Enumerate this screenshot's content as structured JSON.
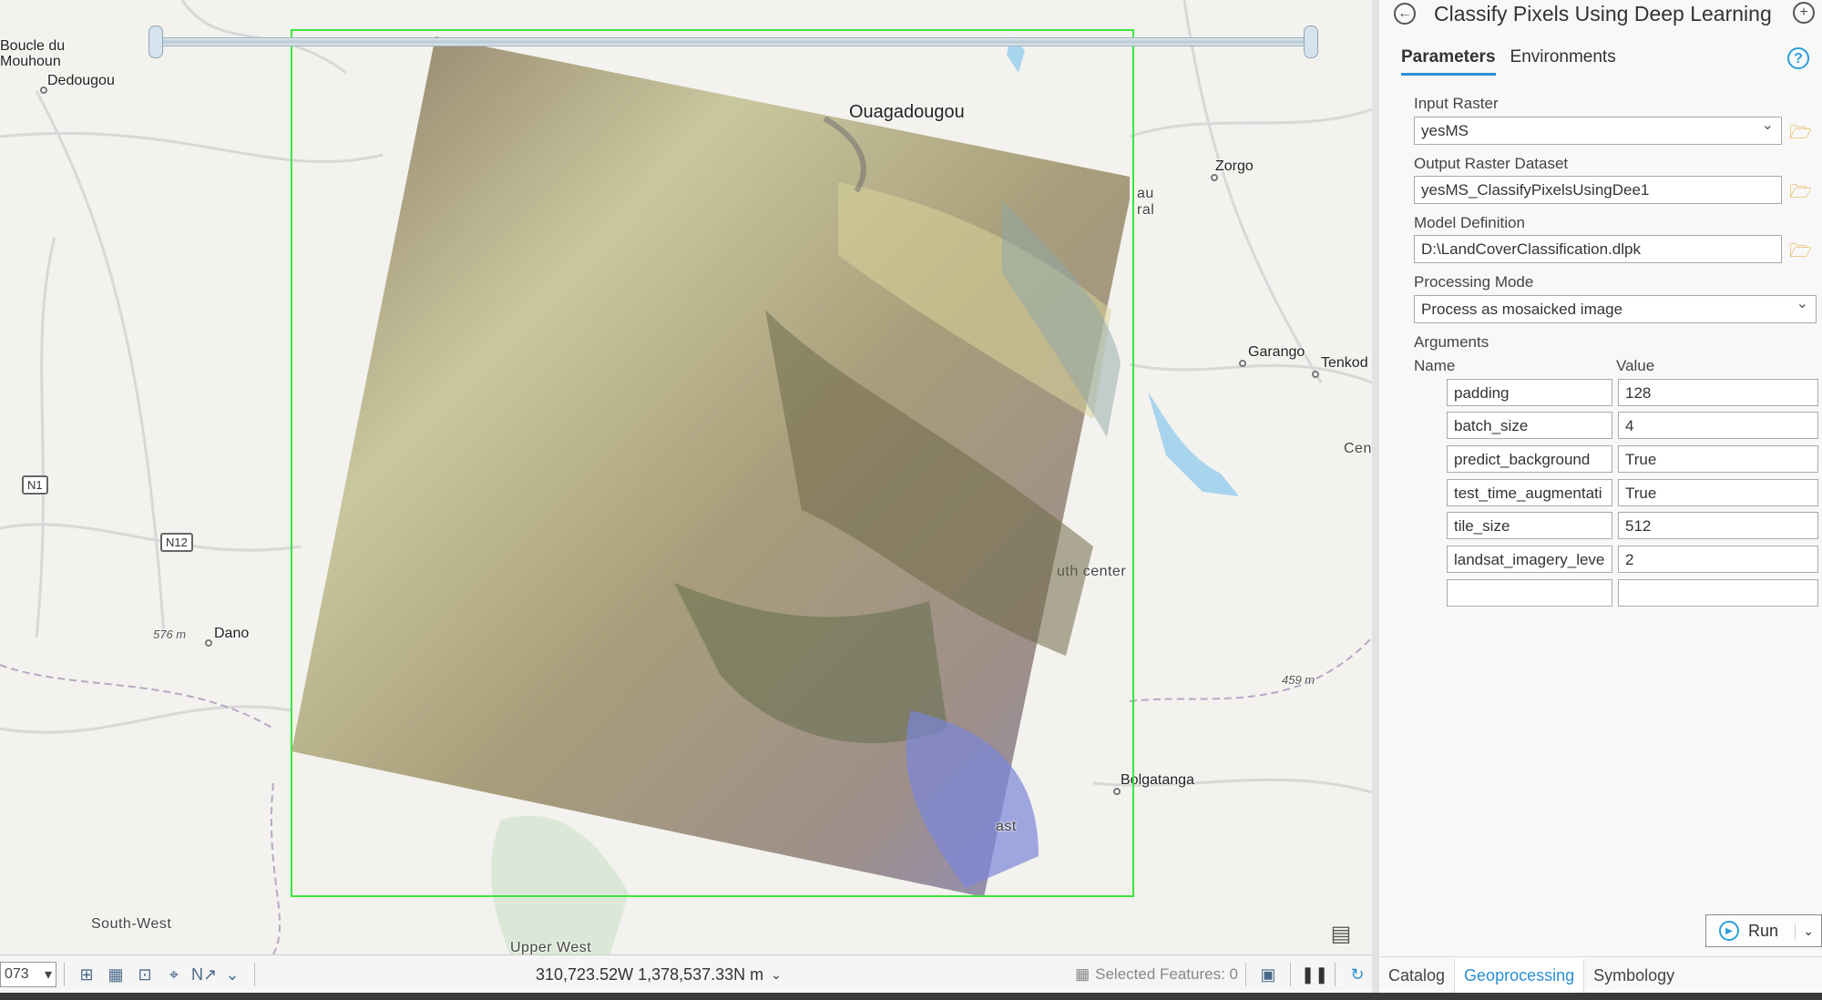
{
  "map": {
    "places": {
      "boucle_du_mouhoun": "Boucle du\nMouhoun",
      "dedougou": "Dedougou",
      "ouagadougou": "Ouagadougou",
      "zorgo": "Zorgo",
      "garango": "Garango",
      "tenkod": "Tenkod",
      "cen": "Cen",
      "au_ral": "au\nral",
      "uth_center": "uth center",
      "dano": "Dano",
      "bolgatanga": "Bolgatanga",
      "south_west": "South-West",
      "upper_west": "Upper West",
      "ast": "ast"
    },
    "elevations": {
      "e1": "576 m",
      "e2": "459 m"
    },
    "highways": {
      "n1": "N1",
      "n12": "N12"
    }
  },
  "statusbar": {
    "scale": "073",
    "coordinates": "310,723.52W 1,378,537.33N m",
    "selected_features": "Selected Features: 0"
  },
  "pane": {
    "title": "Classify Pixels Using Deep Learning",
    "tabs": [
      "Parameters",
      "Environments"
    ],
    "input_raster": {
      "label": "Input Raster",
      "value": "yesMS"
    },
    "output_raster": {
      "label": "Output Raster Dataset",
      "value": "yesMS_ClassifyPixelsUsingDee1"
    },
    "model_definition": {
      "label": "Model Definition",
      "value": "D:\\LandCoverClassification.dlpk"
    },
    "processing_mode": {
      "label": "Processing Mode",
      "value": "Process as mosaicked image"
    },
    "arguments": {
      "label": "Arguments",
      "col_name": "Name",
      "col_value": "Value",
      "rows": [
        {
          "name": "padding",
          "value": "128"
        },
        {
          "name": "batch_size",
          "value": "4"
        },
        {
          "name": "predict_background",
          "value": "True"
        },
        {
          "name": "test_time_augmentati",
          "value": "True"
        },
        {
          "name": "tile_size",
          "value": "512"
        },
        {
          "name": "landsat_imagery_leve",
          "value": "2"
        },
        {
          "name": "",
          "value": ""
        }
      ]
    },
    "run_label": "Run",
    "bottom_tabs": [
      "Catalog",
      "Geoprocessing",
      "Symbology"
    ]
  }
}
